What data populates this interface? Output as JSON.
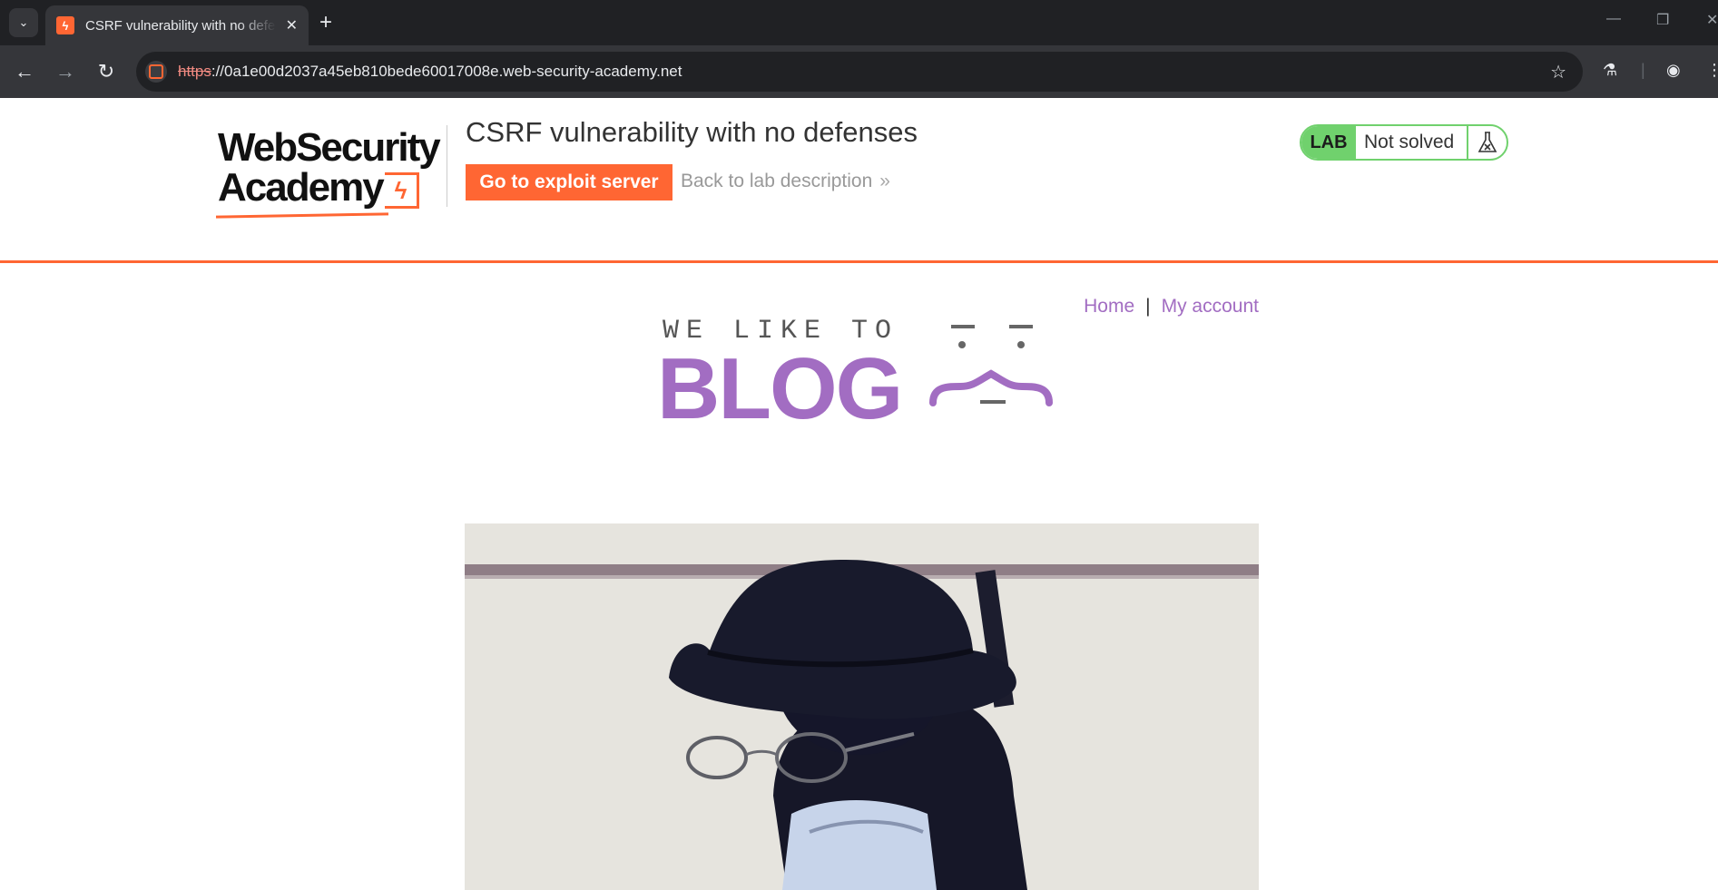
{
  "browser": {
    "tab_title": "CSRF vulnerability with no defenses",
    "tab_close_icon": "close-icon",
    "new_tab_label": "+",
    "url_scheme": "https",
    "url_rest": "://0a1e00d2037a45eb810bede60017008e.web-security-academy.net",
    "icons": [
      "back-arrow-icon",
      "forward-arrow-icon",
      "reload-icon",
      "site-info-icon",
      "bookmark-star-icon",
      "labs-flask-icon",
      "profile-icon",
      "menu-icon"
    ]
  },
  "header": {
    "logo_line1": "WebSecurity",
    "logo_line2": "Academy",
    "lab_title": "CSRF vulnerability with no defenses",
    "exploit_button": "Go to exploit server",
    "back_link": "Back to lab description",
    "back_chevron": "»",
    "status_badge": "LAB",
    "status_text": "Not solved",
    "accent_color": "#ff6633",
    "status_color": "#70d16d"
  },
  "nav": {
    "home": "Home",
    "separator": "|",
    "my_account": "My account",
    "link_color": "#a26dc2"
  },
  "banner": {
    "top_text": "WE LIKE TO",
    "main_text": "BLOG"
  }
}
